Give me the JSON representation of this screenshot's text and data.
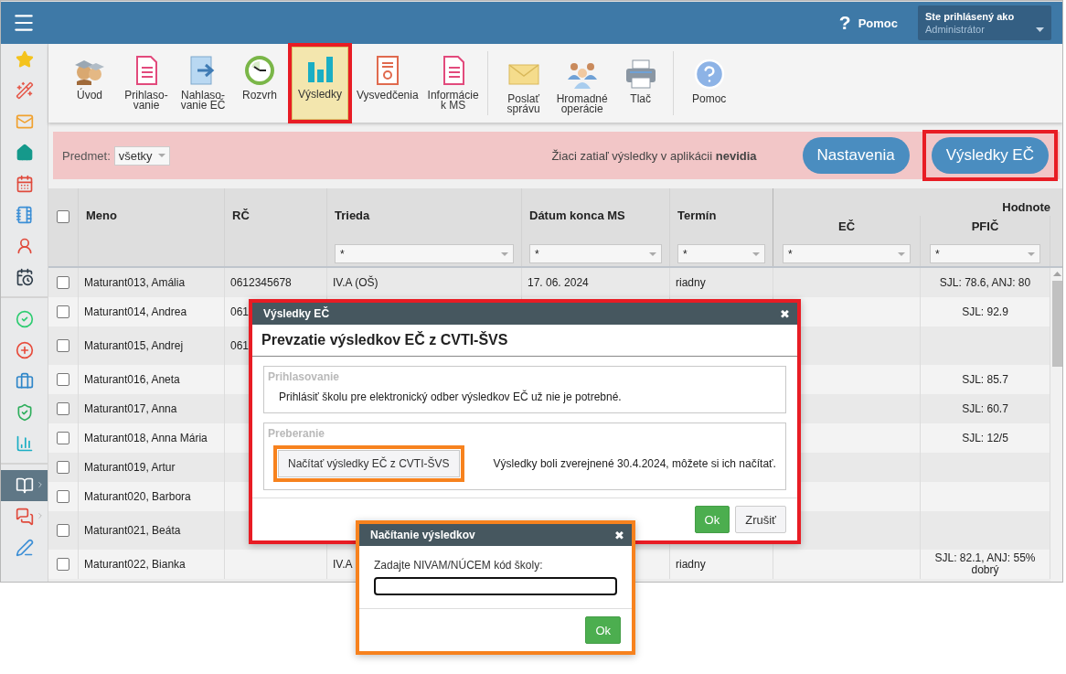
{
  "topbar": {
    "help_mark": "?",
    "help_label": "Pomoc",
    "user": {
      "caption": "Ste prihlásený ako",
      "name": "Administrátor"
    }
  },
  "sidebar": {
    "groups": [
      {
        "items": [
          {
            "selected": false,
            "submenu": false
          },
          {
            "selected": false,
            "submenu": false
          },
          {
            "selected": false,
            "submenu": false
          },
          {
            "selected": false,
            "submenu": false
          },
          {
            "selected": false,
            "submenu": false
          },
          {
            "selected": false,
            "submenu": false
          },
          {
            "selected": false,
            "submenu": false
          },
          {
            "selected": false,
            "submenu": false
          }
        ]
      },
      {
        "items": [
          {
            "selected": false,
            "submenu": false
          },
          {
            "selected": false,
            "submenu": false
          },
          {
            "selected": false,
            "submenu": false
          },
          {
            "selected": false,
            "submenu": false
          },
          {
            "selected": false,
            "submenu": false
          }
        ]
      },
      {
        "items": [
          {
            "selected": true,
            "submenu": true
          },
          {
            "selected": false,
            "submenu": true
          },
          {
            "selected": false,
            "submenu": false
          }
        ]
      }
    ]
  },
  "toolbar": {
    "groups": [
      {
        "items": [
          {
            "label": "Úvod",
            "selected": false,
            "highlighted": false
          },
          {
            "label": "Prihlaso-\nvanie",
            "selected": false,
            "highlighted": false
          },
          {
            "label": "Nahlaso-\nvanie EČ",
            "selected": false,
            "highlighted": false
          },
          {
            "label": "Rozvrh",
            "selected": false,
            "highlighted": false
          },
          {
            "label": "Výsledky",
            "selected": true,
            "highlighted": true
          },
          {
            "label": "Vysvedčenia",
            "selected": false,
            "highlighted": false
          },
          {
            "label": "Informácie\nk MS",
            "selected": false,
            "highlighted": false
          }
        ]
      },
      {
        "items": [
          {
            "label": "Poslať\nsprávu",
            "selected": false,
            "highlighted": false
          },
          {
            "label": "Hromadné\noperácie",
            "selected": false,
            "highlighted": false
          },
          {
            "label": "Tlač",
            "selected": false,
            "highlighted": false
          }
        ]
      },
      {
        "items": [
          {
            "label": "Pomoc",
            "selected": false,
            "highlighted": false
          }
        ]
      }
    ]
  },
  "filter_bar": {
    "subject_label": "Predmet:",
    "subject_value": "všetky",
    "message": "Žiaci zatiaľ výsledky v aplikácii **nevidia**",
    "buttons": [
      {
        "label": "Nastavenia",
        "highlighted": false
      },
      {
        "label": "Výsledky EČ",
        "highlighted": true
      }
    ]
  },
  "table": {
    "all_checked": false,
    "group_header": "Hodnote",
    "columns": [
      {
        "label": "Meno",
        "group": false
      },
      {
        "label": "RČ",
        "group": false
      },
      {
        "label": "Trieda",
        "filter": "*",
        "group": false
      },
      {
        "label": "Dátum konca MS",
        "filter": "*",
        "group": false
      },
      {
        "label": "Termín",
        "filter": "*",
        "group": false
      },
      {
        "label": "EČ",
        "filter": "*",
        "group": true
      },
      {
        "label": "PFIČ",
        "filter": "*",
        "group": true
      }
    ],
    "rows": [
      {
        "checked": false,
        "tall": false,
        "name": "Maturant013, Amália",
        "rc": "0612345678",
        "class": "IV.A (OŠ)",
        "end_date": "17. 06. 2024",
        "term": "riadny",
        "pfic": [
          "SJL: 78.6, ANJ: 80"
        ]
      },
      {
        "checked": false,
        "tall": false,
        "name": "Maturant014, Andrea",
        "rc": "061",
        "pfic": [
          "SJL: 92.9"
        ]
      },
      {
        "checked": false,
        "tall": true,
        "name": "Maturant015, Andrej",
        "rc": "061"
      },
      {
        "checked": false,
        "tall": false,
        "name": "Maturant016, Aneta",
        "pfic": [
          "SJL: 85.7"
        ]
      },
      {
        "checked": false,
        "tall": false,
        "name": "Maturant017, Anna",
        "pfic": [
          "SJL: 60.7"
        ]
      },
      {
        "checked": false,
        "tall": false,
        "name": "Maturant018, Anna Mária",
        "pfic": [
          "SJL: 12/5"
        ]
      },
      {
        "checked": false,
        "tall": false,
        "name": "Maturant019, Artur"
      },
      {
        "checked": false,
        "tall": false,
        "name": "Maturant020, Barbora"
      },
      {
        "checked": false,
        "tall": true,
        "name": "Maturant021, Beáta"
      },
      {
        "checked": false,
        "tall": false,
        "name": "Maturant022, Bianka",
        "class": "IV.A",
        "term": "riadny",
        "pfic": [
          "SJL: 82.1, ANJ: 55%",
          "dobrý"
        ]
      }
    ]
  },
  "results_dialog": {
    "highlighted": true,
    "title": "Výsledky EČ",
    "close": "✖",
    "heading": "Prevzatie výsledkov EČ z CVTI-ŠVS",
    "sections": [
      {
        "legend": "Prihlasovanie",
        "text": "Prihlásiť školu pre elektronický odber výsledkov EČ už nie je potrebné."
      },
      {
        "legend": "Preberanie",
        "button": {
          "label": "Načítať výsledky EČ z CVTI-ŠVS",
          "highlighted": true
        },
        "text": "Výsledky boli zverejnené 30.4.2024, môžete si ich načítať."
      }
    ],
    "buttons": [
      {
        "label": "Ok",
        "kind": "primary"
      },
      {
        "label": "Zrušiť",
        "kind": "default"
      }
    ]
  },
  "load_dialog": {
    "highlighted": true,
    "title": "Načítanie výsledkov",
    "close": "✖",
    "field_label": "Zadajte NIVAM/NÚCEM kód školy:",
    "field_focused": true,
    "buttons": [
      {
        "label": "Ok",
        "kind": "primary"
      }
    ]
  }
}
